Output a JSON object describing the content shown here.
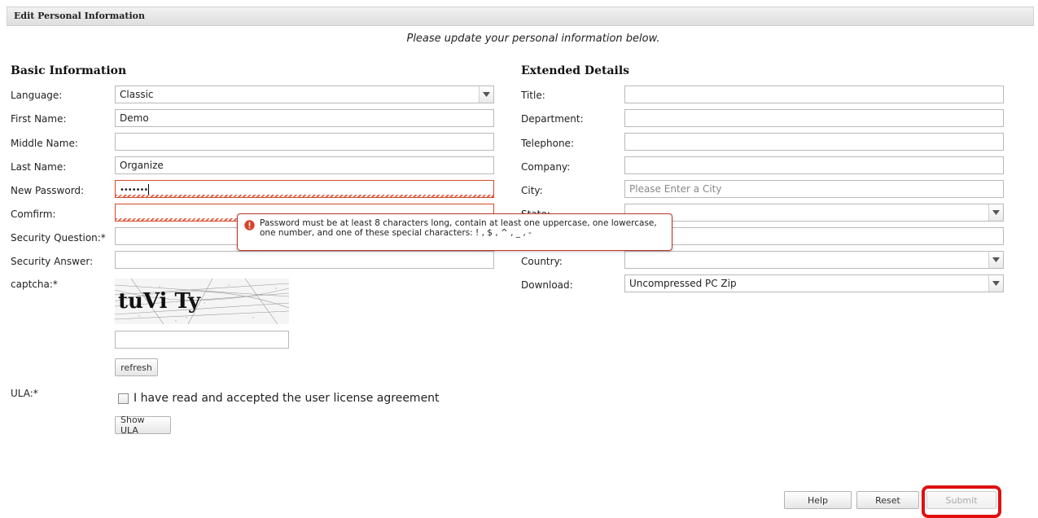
{
  "panel": {
    "title": "Edit Personal Information",
    "subtitle": "Please update your personal information below."
  },
  "basic": {
    "title": "Basic Information",
    "language": {
      "label": "Language:",
      "value": "Classic"
    },
    "first_name": {
      "label": "First Name:",
      "value": "Demo"
    },
    "middle_name": {
      "label": "Middle Name:",
      "value": ""
    },
    "last_name": {
      "label": "Last Name:",
      "value": "Organize"
    },
    "new_password": {
      "label": "New Password:",
      "value": "•••••••"
    },
    "confirm": {
      "label": "Comfirm:",
      "value": ""
    },
    "security_question": {
      "label": "Security Question:*",
      "value": ""
    },
    "security_answer": {
      "label": "Security Answer:",
      "value": ""
    },
    "captcha": {
      "label": "captcha:*",
      "text": "tuVi Ty",
      "input_value": "",
      "refresh_label": "refresh"
    },
    "ula": {
      "label": "ULA:*",
      "checkbox_label": "I have read and accepted the user license agreement",
      "checked": false,
      "show_label": "Show ULA"
    }
  },
  "extended": {
    "title": "Extended Details",
    "title_field": {
      "label": "Title:",
      "value": ""
    },
    "department": {
      "label": "Department:",
      "value": ""
    },
    "telephone": {
      "label": "Telephone:",
      "value": ""
    },
    "company": {
      "label": "Company:",
      "value": ""
    },
    "city": {
      "label": "City:",
      "placeholder": "Please Enter a City",
      "value": ""
    },
    "state": {
      "label": "State:",
      "value": ""
    },
    "zip": {
      "label": "",
      "value": ""
    },
    "country": {
      "label": "Country:",
      "value": ""
    },
    "download": {
      "label": "Download:",
      "value": "Uncompressed PC Zip"
    }
  },
  "tooltip": {
    "icon": "error-icon",
    "line1": "Password must be at least 8 characters long, contain at least one uppercase, one lowercase,",
    "line2": "one number, and one of these special characters: ! , $ , ^ , _ , -"
  },
  "footer": {
    "help_label": "Help",
    "reset_label": "Reset",
    "submit_label": "Submit",
    "submit_disabled": true
  },
  "colors": {
    "error": "#d64a2a",
    "highlight": "#e01010"
  }
}
